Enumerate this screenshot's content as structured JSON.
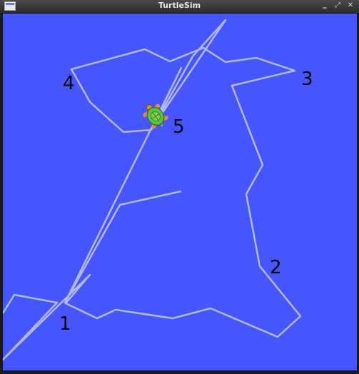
{
  "window": {
    "title": "TurtleSim",
    "controls": {
      "minimize": "‗",
      "maximize": "⤢",
      "close": "✕"
    }
  },
  "canvas": {
    "background_color": "#4556ff",
    "path_color": "#b3b8ff",
    "waypoint_labels": [
      "1",
      "2",
      "3",
      "4",
      "5"
    ]
  },
  "turtle": {
    "icon": "turtle-icon"
  }
}
